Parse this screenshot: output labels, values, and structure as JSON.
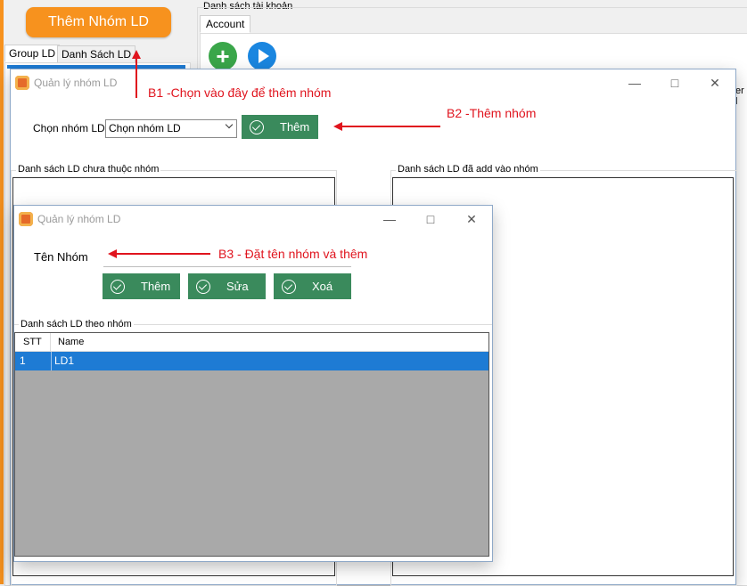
{
  "main": {
    "add_group_button": "Thêm Nhóm LD",
    "left_tabs": [
      "Group LD",
      "Danh Sách LD"
    ],
    "account_list_label": "Danh sách tài khoản",
    "account_tab": "Account",
    "right_cut_text": "er l"
  },
  "window1": {
    "title": "Quản lý nhóm LD",
    "choose_label": "Chọn nhóm LD",
    "select_value": "Chọn nhóm LD",
    "add_button": "Thêm",
    "group_left": "Danh sách LD chưa thuộc nhóm",
    "group_right": "Danh sách LD đã add vào nhóm"
  },
  "window2": {
    "title": "Quản lý nhóm LD",
    "name_label": "Tên Nhóm",
    "name_value": "",
    "buttons": {
      "add": "Thêm",
      "edit": "Sửa",
      "delete": "Xoá"
    },
    "list_group": "Danh sách LD theo nhóm",
    "columns": [
      "STT",
      "Name"
    ],
    "rows": [
      {
        "stt": "1",
        "name": "LD1"
      }
    ]
  },
  "annotations": {
    "b1": "B1 -Chọn vào đây để thêm nhóm",
    "b2": "B2 -Thêm nhóm",
    "b3": "B3 - Đặt tên nhóm và thêm"
  },
  "colors": {
    "accent_orange": "#f7921e",
    "button_green": "#3a8a5c",
    "selection_blue": "#1e7bd4",
    "annotation_red": "#e0141e"
  }
}
